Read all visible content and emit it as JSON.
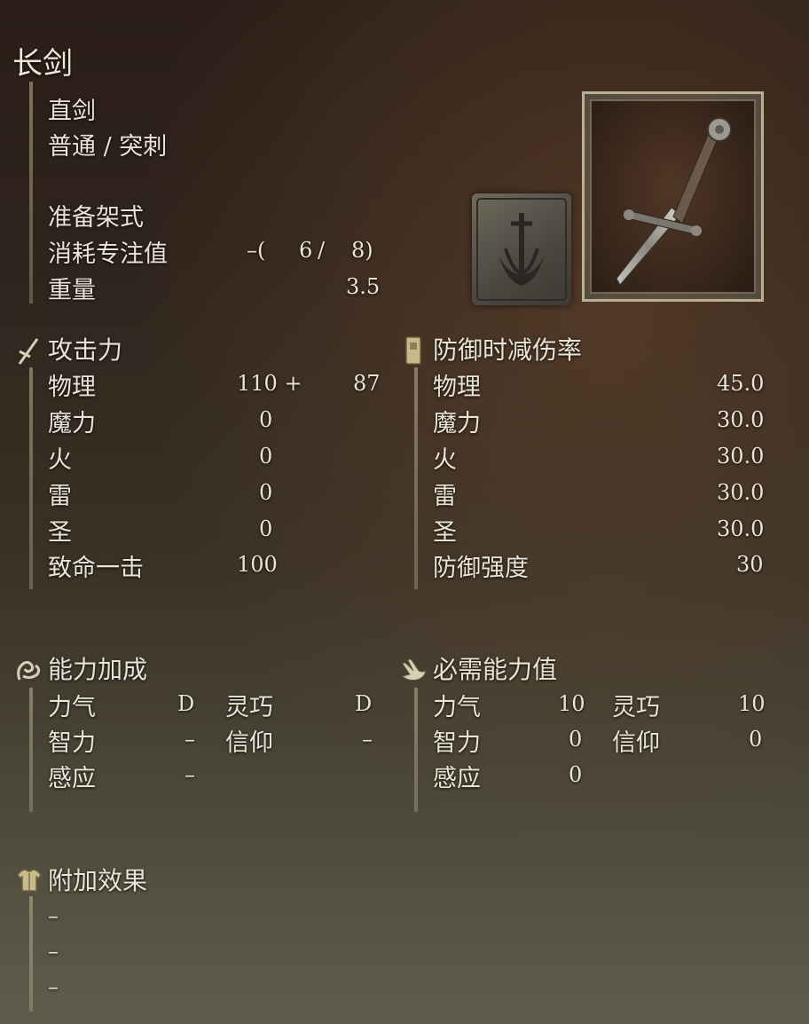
{
  "weapon": {
    "name": "长剑",
    "type": "直剑",
    "damage_type": "普通 / 突刺",
    "skill": "准备架式",
    "fp_label": "消耗专注值",
    "fp_dash": "–(",
    "fp_1": "6",
    "fp_sep": "/",
    "fp_2": "8)",
    "weight_label": "重量",
    "weight_value": "3.5"
  },
  "attack": {
    "heading": "攻击力",
    "rows": [
      {
        "label": "物理",
        "value": "110 +",
        "bonus": "87"
      },
      {
        "label": "魔力",
        "value": "0"
      },
      {
        "label": "火",
        "value": "0"
      },
      {
        "label": "雷",
        "value": "0"
      },
      {
        "label": "圣",
        "value": "0"
      },
      {
        "label": "致命一击",
        "value": "100"
      }
    ]
  },
  "guard": {
    "heading": "防御时减伤率",
    "rows": [
      {
        "label": "物理",
        "value": "45.0"
      },
      {
        "label": "魔力",
        "value": "30.0"
      },
      {
        "label": "火",
        "value": "30.0"
      },
      {
        "label": "雷",
        "value": "30.0"
      },
      {
        "label": "圣",
        "value": "30.0"
      },
      {
        "label": "防御强度",
        "value": "30"
      }
    ]
  },
  "scaling": {
    "heading": "能力加成",
    "rows": [
      {
        "label": "力气",
        "value": "D",
        "label2": "灵巧",
        "value2": "D"
      },
      {
        "label": "智力",
        "value": "–",
        "label2": "信仰",
        "value2": "–"
      },
      {
        "label": "感应",
        "value": "–"
      }
    ]
  },
  "requirements": {
    "heading": "必需能力值",
    "rows": [
      {
        "label": "力气",
        "value": "10",
        "label2": "灵巧",
        "value2": "10"
      },
      {
        "label": "智力",
        "value": "0",
        "label2": "信仰",
        "value2": "0"
      },
      {
        "label": "感应",
        "value": "0"
      }
    ]
  },
  "passive": {
    "heading": "附加效果",
    "items": [
      "–",
      "–",
      "–"
    ]
  },
  "icons": {
    "attack": "sword-icon",
    "guard": "shield-icon",
    "scaling": "flexed-arm-icon",
    "requirements": "hand-icon",
    "passive": "armor-icon"
  }
}
